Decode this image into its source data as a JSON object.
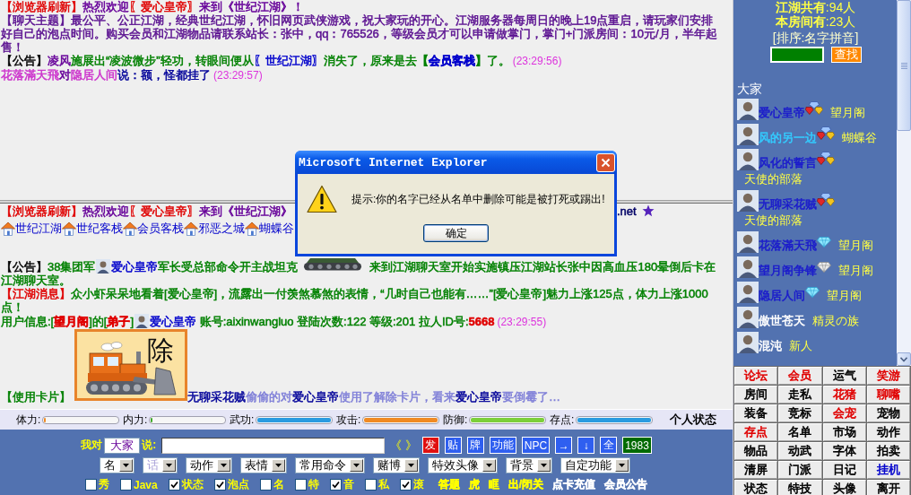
{
  "chat_upper": {
    "messages": [
      {
        "segments": [
          {
            "kind": "text",
            "parts": [
              {
                "text": "【浏览器刷新】",
                "color": "#e00000"
              },
              {
                "text": "热烈欢迎",
                "color": "#660099"
              },
              {
                "text": "〖爱心皇帝〗",
                "color": "#e00000"
              },
              {
                "text": "来到《世纪江湖》！",
                "color": "#660099"
              }
            ]
          }
        ]
      },
      {
        "segments": [
          {
            "kind": "text",
            "parts": [
              {
                "text": "【聊天主题】最公平、公正江湖，经典世纪江湖，怀旧网页武侠游戏，祝大家玩的开心。江湖服务器每周日的晚上19点重启，请玩家们安排好自己的泡点时间。购买会员和江湖物品请联系站长：张中，qq：765526，等级会员才可以申请做掌门，掌门+门派房间：10元/月，半年起售！",
                "color": "#5a1090"
              }
            ]
          }
        ]
      },
      {
        "segments": [
          {
            "kind": "text",
            "parts": [
              {
                "text": "【公告】",
                "color": "#000000"
              },
              {
                "text": "凌风",
                "color": "#660099"
              },
              {
                "text": "施展出“凌波微步”轻功，转眼间便从",
                "color": "#008000"
              },
              {
                "text": "〖世纪江湖〗",
                "color": "#0000cc"
              },
              {
                "text": "消失了，原来是去",
                "color": "#008000"
              },
              {
                "text": "**【**",
                "color": "#008000"
              },
              {
                "text": "**会员客栈**",
                "color": "#0000cc"
              },
              {
                "text": "**】**了。",
                "color": "#008000"
              }
            ]
          },
          {
            "kind": "time",
            "text": "(23:29:56)"
          }
        ]
      },
      {
        "segments": [
          {
            "kind": "text",
            "parts": [
              {
                "text": "花落滿天飛",
                "color": "#cc33cc"
              },
              {
                "text": "对",
                "color": "#660099"
              },
              {
                "text": "隐居人间",
                "color": "#cc33cc"
              },
              {
                "text": "说：额，怪都挂了",
                "color": "#000099"
              }
            ]
          },
          {
            "kind": "time",
            "text": "(23:29:57)"
          }
        ]
      }
    ]
  },
  "chat_lower": {
    "messages": [
      {
        "segments": [
          {
            "kind": "text",
            "parts": [
              {
                "text": "【浏览器刷新】",
                "color": "#e00000"
              },
              {
                "text": "热烈欢迎",
                "color": "#660099"
              },
              {
                "text": "〖爱心皇帝〗",
                "color": "#e00000"
              },
              {
                "text": "来到《世纪江湖》",
                "color": "#660099"
              }
            ]
          },
          {
            "kind": "covered"
          },
          {
            "kind": "text",
            "parts": [
              {
                "text": ".net",
                "color": "#000066"
              }
            ]
          },
          {
            "kind": "star"
          }
        ]
      },
      {
        "segments": [
          {
            "kind": "house"
          },
          {
            "kind": "link",
            "text": "世纪江湖"
          },
          {
            "kind": "house"
          },
          {
            "kind": "link",
            "text": "世纪客栈"
          },
          {
            "kind": "house"
          },
          {
            "kind": "link",
            "text": "会员客栈"
          },
          {
            "kind": "house"
          },
          {
            "kind": "link",
            "text": "邪恶之城"
          },
          {
            "kind": "house"
          },
          {
            "kind": "link",
            "text": "蝴蝶谷"
          }
        ]
      },
      {
        "segments": [
          {
            "kind": "text",
            "parts": [
              {
                "text": "【公告】",
                "color": "#000000"
              },
              {
                "text": "38集团军",
                "color": "#008000"
              }
            ]
          },
          {
            "kind": "avatar"
          },
          {
            "kind": "text",
            "parts": [
              {
                "text": "爱心皇帝",
                "color": "#0000cc"
              },
              {
                "text": "军长受总部命令开主战坦克",
                "color": "#008000"
              }
            ]
          },
          {
            "kind": "tank"
          },
          {
            "kind": "text",
            "parts": [
              {
                "text": "来到江湖聊天室开始实施镇压江湖站长张中因高血压180晕倒后卡在",
                "color": "#008000"
              }
            ]
          },
          {
            "kind": "break"
          },
          {
            "kind": "text",
            "parts": [
              {
                "text": "江湖聊天室。",
                "color": "#008000"
              }
            ]
          }
        ]
      },
      {
        "segments": [
          {
            "kind": "text",
            "parts": [
              {
                "text": "【江湖消息】",
                "color": "#e00000"
              },
              {
                "text": "众小虾呆呆地看着[爱心皇帝]，流露出一付羡煞慕煞的表情，“几时自己也能有……”[爱心皇帝]魅力上涨125点，体力上涨1000点！",
                "color": "#008000"
              }
            ]
          }
        ]
      },
      {
        "segments": [
          {
            "kind": "text",
            "parts": [
              {
                "text": "用户信息:[",
                "color": "#008000"
              },
              {
                "text": "**望月阁**",
                "color": "#e00000"
              },
              {
                "text": "]的[",
                "color": "#008000"
              },
              {
                "text": "**弟子**",
                "color": "#e00000"
              },
              {
                "text": "]",
                "color": "#008000"
              }
            ]
          },
          {
            "kind": "avatar"
          },
          {
            "kind": "text",
            "parts": [
              {
                "text": "爱心皇帝",
                "color": "#0000cc"
              },
              {
                "text": " 账号:aixinwangluo 登陆次数:122 等级:201 拉人ID号:",
                "color": "#008000"
              },
              {
                "text": "**5668**",
                "color": "#e00000"
              }
            ]
          },
          {
            "kind": "time",
            "text": "(23:29:55)"
          }
        ]
      },
      {
        "segments": [
          {
            "kind": "text",
            "parts": [
              {
                "text": "【使用卡片】",
                "color": "#008000"
              }
            ]
          },
          {
            "kind": "card",
            "caption": "除"
          },
          {
            "kind": "text",
            "parts": [
              {
                "text": "无聊采花贼",
                "color": "#000099"
              },
              {
                "text": "偷偷的对",
                "color": "#8080d8"
              },
              {
                "text": "爱心皇帝",
                "color": "#000099"
              },
              {
                "text": "使用了解除卡片，看来",
                "color": "#8080d8"
              },
              {
                "text": "爱心皇帝",
                "color": "#000099"
              },
              {
                "text": "要倒霉了…",
                "color": "#8080d8"
              }
            ]
          }
        ]
      }
    ]
  },
  "dialog": {
    "title": "Microsoft Internet Explorer",
    "message": "提示:你的名字已经从名单中删除可能是被打死或踢出!",
    "button": "确定"
  },
  "status_bar": {
    "stats": [
      {
        "label": "体力:",
        "level": 0.03,
        "color": "#f08a24"
      },
      {
        "label": "内力:",
        "level": 0.03,
        "color": "#3fa82a"
      },
      {
        "label": "武功:",
        "level": 1,
        "color": "#2a9be0"
      },
      {
        "label": "攻击:",
        "level": 1,
        "color": "#f08a24"
      },
      {
        "label": "防御:",
        "level": 1,
        "color": "#7ccf3a"
      },
      {
        "label": "存点:",
        "level": 1,
        "color": "#2a9be0"
      }
    ],
    "title": "个人状态"
  },
  "toolbar": {
    "speaker_label": "我对",
    "recipient": "大家",
    "say_label": "说:",
    "bracket_button": "《 》",
    "buttons": [
      {
        "label": "发",
        "color": "#e01010"
      },
      {
        "label": "贴",
        "color": "#2f5ff0"
      },
      {
        "label": "牌",
        "color": "#2f5ff0"
      },
      {
        "label": "功能",
        "color": "#2f5ff0"
      },
      {
        "label": "NPC",
        "color": "#2f5ff0"
      },
      {
        "label": "→",
        "color": "#2f5ff0"
      },
      {
        "label": "↓",
        "color": "#2f5ff0"
      },
      {
        "label": "全",
        "color": "#2f5ff0"
      },
      {
        "label": "1983",
        "color": "#006a00"
      }
    ],
    "selects": [
      {
        "label": "名",
        "disabled": false
      },
      {
        "label": "话",
        "disabled": true
      },
      {
        "label": "动作",
        "disabled": false
      },
      {
        "label": "表情",
        "disabled": false
      },
      {
        "label": "常用命令",
        "disabled": false
      },
      {
        "label": "赌博",
        "disabled": false
      },
      {
        "label": "特效头像",
        "disabled": false
      },
      {
        "label": "背景",
        "disabled": false
      },
      {
        "label": "自定功能",
        "disabled": false
      }
    ],
    "checkboxes": [
      {
        "label": "秀",
        "checked": false
      },
      {
        "label": "Java",
        "checked": false
      },
      {
        "label": "状态",
        "checked": true
      },
      {
        "label": "泡点",
        "checked": true
      },
      {
        "label": "名",
        "checked": false
      },
      {
        "label": "特",
        "checked": false
      },
      {
        "label": "音",
        "checked": true
      },
      {
        "label": "私",
        "checked": false
      },
      {
        "label": "滚",
        "checked": true
      }
    ],
    "links": [
      {
        "label": "答题",
        "color": "#ffff00"
      },
      {
        "label": "虎",
        "color": "#ffff00"
      },
      {
        "label": "眶",
        "color": "#ffff00"
      },
      {
        "label": "出/闭关",
        "color": "#ffff00"
      },
      {
        "label": "点卡充值",
        "color": "#ffffff"
      },
      {
        "label": "会员公告",
        "color": "#ffffff"
      }
    ]
  },
  "sidebar": {
    "total": "**江湖共有**:94人",
    "room": "**本房间有**:23人",
    "sort": "[排序:名字拼音]",
    "search_button": "查找",
    "everyone": "大家",
    "users": [
      {
        "name": "爱心皇帝",
        "color": "#1a1acc",
        "kind": "gems",
        "group": "望月阁"
      },
      {
        "name": "风的另一边",
        "color": "#33ccff",
        "kind": "gems",
        "group": "蝴蝶谷"
      },
      {
        "name": "风化的誓言",
        "color": "#1a1acc",
        "kind": "gems",
        "group": "天使的部落"
      },
      {
        "name": "无聊采花贼",
        "color": "#1a1acc",
        "kind": "gems",
        "group": "天使的部落"
      },
      {
        "name": "花落滿天飛",
        "color": "#1a1acc",
        "kind": "diamond",
        "group": "望月阁"
      },
      {
        "name": "望月阁争锋",
        "color": "#1a1acc",
        "kind": "silver",
        "group": "望月阁"
      },
      {
        "name": "隐居人间",
        "color": "#1a1acc",
        "kind": "diamond",
        "group": "望月阁"
      },
      {
        "name": "傲世苍天",
        "color": "#ffffff",
        "kind": "plain",
        "group": "精灵の族"
      },
      {
        "name": "混沌",
        "color": "#ffffff",
        "kind": "plain",
        "group": "新人"
      }
    ]
  },
  "menu_grid": {
    "items": [
      {
        "label": "论坛",
        "color": "#e00000"
      },
      {
        "label": "会员",
        "color": "#e00000"
      },
      {
        "label": "运气",
        "color": "#000000"
      },
      {
        "label": "笑游",
        "color": "#e00000"
      },
      {
        "label": "房间",
        "color": "#000000"
      },
      {
        "label": "走私",
        "color": "#000000"
      },
      {
        "label": "花猪",
        "color": "#e00000"
      },
      {
        "label": "聊嘴",
        "color": "#e00000"
      },
      {
        "label": "装备",
        "color": "#000000"
      },
      {
        "label": "竞标",
        "color": "#000000"
      },
      {
        "label": "会宠",
        "color": "#e00000"
      },
      {
        "label": "宠物",
        "color": "#000000"
      },
      {
        "label": "存点",
        "color": "#e00000"
      },
      {
        "label": "名单",
        "color": "#000000"
      },
      {
        "label": "市场",
        "color": "#000000"
      },
      {
        "label": "动作",
        "color": "#000000"
      },
      {
        "label": "物品",
        "color": "#000000"
      },
      {
        "label": "动武",
        "color": "#000000"
      },
      {
        "label": "字体",
        "color": "#000000"
      },
      {
        "label": "拍卖",
        "color": "#000000"
      },
      {
        "label": "清屏",
        "color": "#000000"
      },
      {
        "label": "门派",
        "color": "#000000"
      },
      {
        "label": "日记",
        "color": "#000000"
      },
      {
        "label": "挂机",
        "color": "#0000cc"
      },
      {
        "label": "状态",
        "color": "#000000"
      },
      {
        "label": "特技",
        "color": "#000000"
      },
      {
        "label": "头像",
        "color": "#000000"
      },
      {
        "label": "离开",
        "color": "#000000"
      }
    ]
  }
}
